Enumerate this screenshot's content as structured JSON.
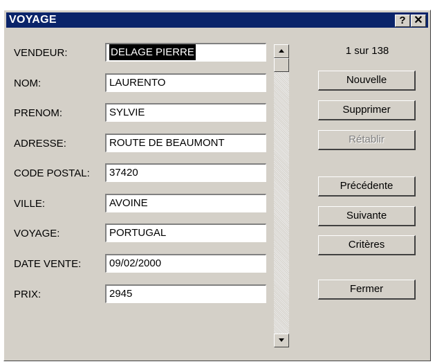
{
  "window": {
    "title": "VOYAGE",
    "help_glyph": "?",
    "close_glyph": "✕"
  },
  "fields": [
    {
      "label": "VENDEUR:",
      "value": "DELAGE PIERRE"
    },
    {
      "label": "NOM:",
      "value": "LAURENTO"
    },
    {
      "label": "PRENOM:",
      "value": "SYLVIE"
    },
    {
      "label": "ADRESSE:",
      "value": "ROUTE DE BEAUMONT"
    },
    {
      "label": "CODE POSTAL:",
      "value": "37420"
    },
    {
      "label": "VILLE:",
      "value": "AVOINE"
    },
    {
      "label": "VOYAGE:",
      "value": "PORTUGAL"
    },
    {
      "label": "DATE VENTE:",
      "value": "09/02/2000"
    },
    {
      "label": "PRIX:",
      "value": "2945"
    }
  ],
  "record_counter": "1 sur 138",
  "buttons": {
    "nouvelle": "Nouvelle",
    "supprimer": "Supprimer",
    "retablir": "Rétablir",
    "precedente": "Précédente",
    "suivante": "Suivante",
    "criteres": "Critères",
    "fermer": "Fermer"
  }
}
